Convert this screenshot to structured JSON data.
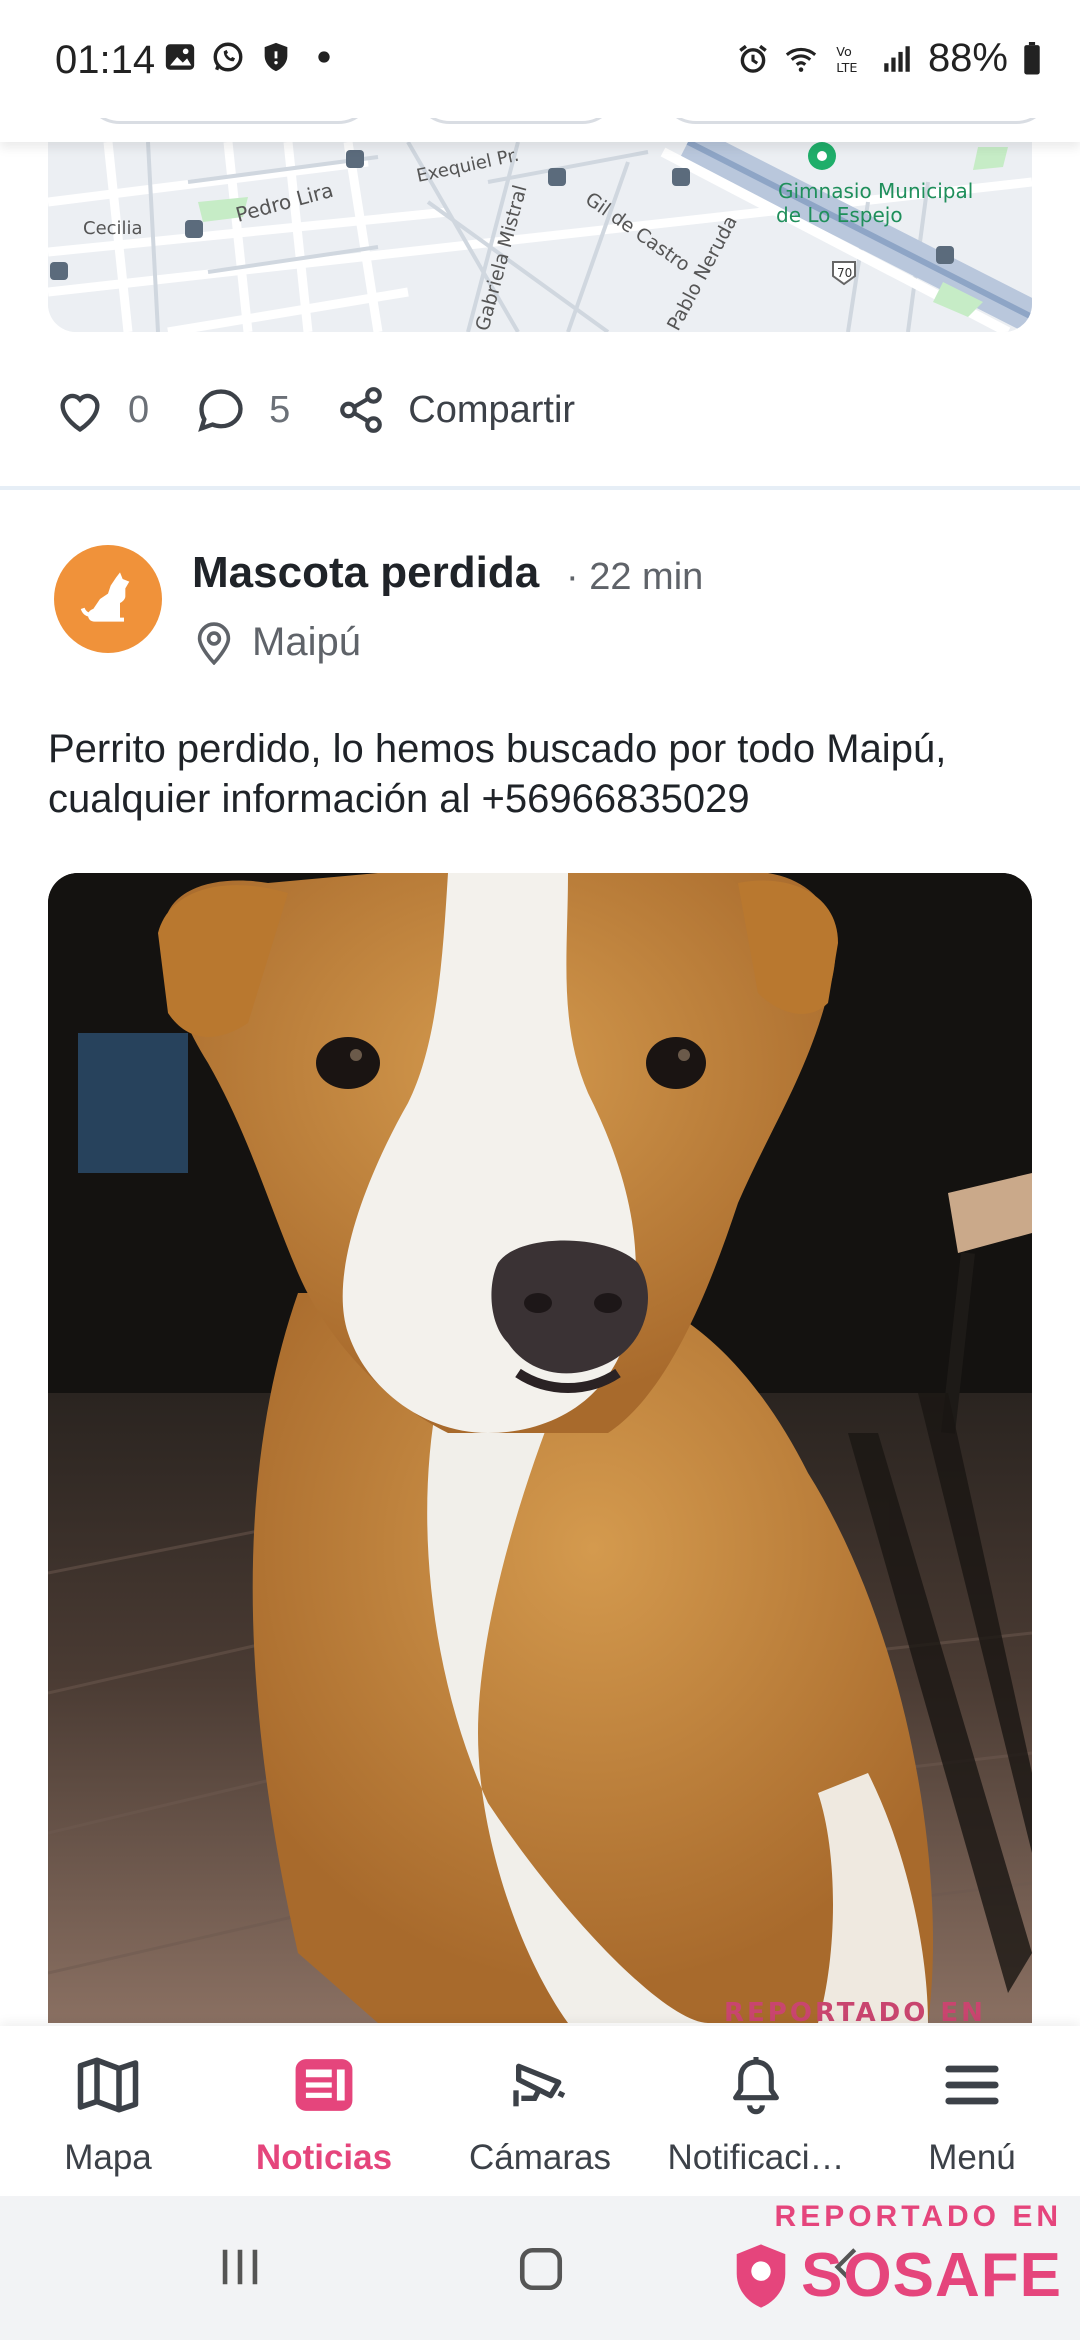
{
  "status_bar": {
    "time": "01:14",
    "battery": "88%",
    "left_icons": [
      "gallery-icon",
      "whatsapp-icon",
      "shield-icon",
      "dot-icon"
    ],
    "right_icons": [
      "alarm-icon",
      "wifi-icon",
      "volte-icon",
      "signal-icon",
      "battery-icon"
    ]
  },
  "map": {
    "labels": {
      "cecilia": "Cecilia",
      "pedro_lira": "Pedro Lira",
      "exequiel": "Exequiel Pr.",
      "gil_de_castro": "Gil de Castro",
      "gabriela_mistral": "Gabriela Mistral",
      "pablo_neruda": "Pablo Neruda",
      "gimnasio": "Gimnasio Municipal",
      "lo_espejo": "de Lo Espejo",
      "route": "70"
    }
  },
  "previous_post_actions": {
    "likes": "0",
    "comments": "5",
    "share_label": "Compartir"
  },
  "post": {
    "category": "Mascota perdida",
    "time": "· 22 min",
    "location": "Maipú",
    "text": "Perrito perdido, lo hemos buscado por todo Maipú, cualquier información al +56966835029",
    "photo_watermark": "REPORTADO EN"
  },
  "bottom_nav": {
    "items": [
      {
        "label": "Mapa",
        "icon": "map-icon",
        "active": false
      },
      {
        "label": "Noticias",
        "icon": "news-icon",
        "active": true
      },
      {
        "label": "Cámaras",
        "icon": "camera-icon",
        "active": false
      },
      {
        "label": "Notificaci…",
        "icon": "bell-icon",
        "active": false
      },
      {
        "label": "Menú",
        "icon": "hamburger-icon",
        "active": false
      }
    ]
  },
  "watermark": {
    "line1": "REPORTADO EN",
    "brand": "SOSAFE"
  },
  "colors": {
    "accent": "#e5457c",
    "avatar": "#f0923a",
    "text": "#1f2328",
    "muted": "#5f6369"
  }
}
